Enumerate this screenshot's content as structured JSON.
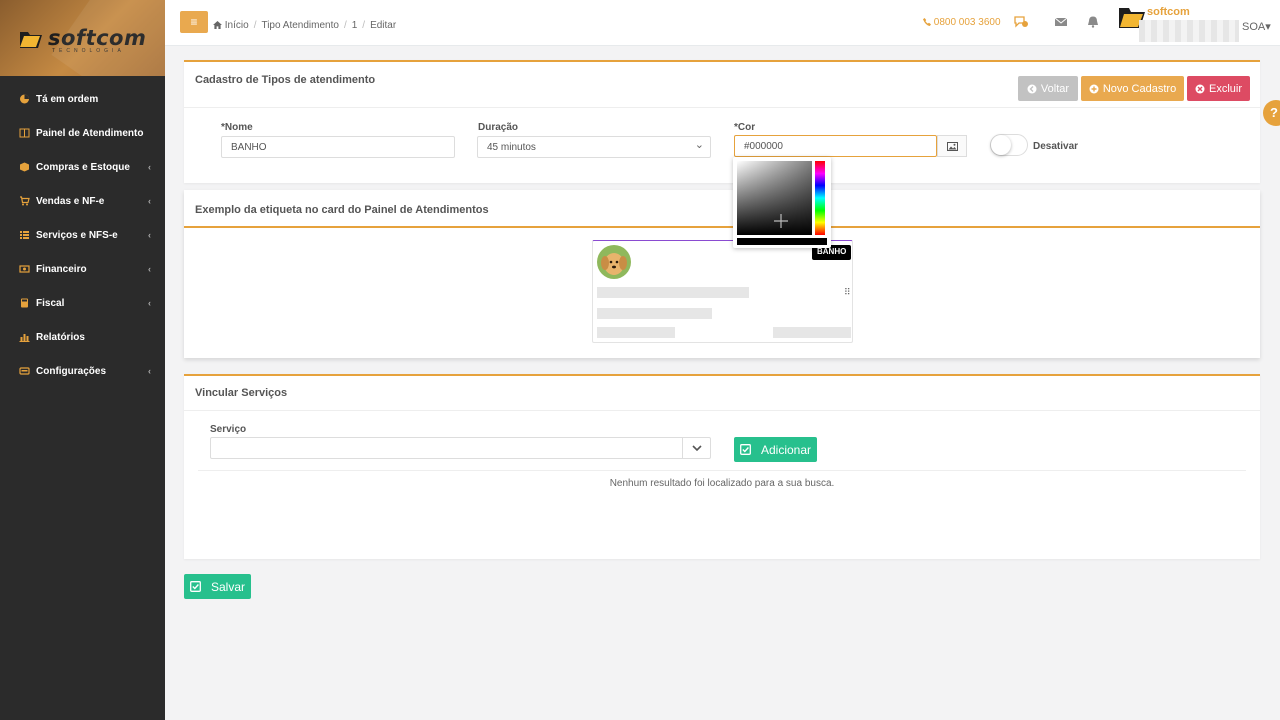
{
  "brand": {
    "logo_text": "softcom",
    "logo_sub": "TECNOLOGIA",
    "topbar_brand": "softcom",
    "user_suffix": "SOA▾"
  },
  "sidebar": {
    "items": [
      {
        "label": "Tá em ordem",
        "icon": "pie-chart-icon",
        "chevron": false
      },
      {
        "label": "Painel de Atendimento",
        "icon": "columns-icon",
        "chevron": false
      },
      {
        "label": "Compras e Estoque",
        "icon": "box-icon",
        "chevron": true
      },
      {
        "label": "Vendas e NF-e",
        "icon": "cart-icon",
        "chevron": true
      },
      {
        "label": "Serviços e NFS-e",
        "icon": "list-icon",
        "chevron": true
      },
      {
        "label": "Financeiro",
        "icon": "money-icon",
        "chevron": true
      },
      {
        "label": "Fiscal",
        "icon": "calculator-icon",
        "chevron": true
      },
      {
        "label": "Relatórios",
        "icon": "bar-chart-icon",
        "chevron": false
      },
      {
        "label": "Configurações",
        "icon": "keyboard-icon",
        "chevron": true
      }
    ],
    "chevron_glyph": "‹"
  },
  "topbar": {
    "menu_glyph": "≡",
    "breadcrumbs": [
      "Início",
      "Tipo Atendimento",
      "1",
      "Editar"
    ],
    "phone": "0800 003 3600"
  },
  "cadastro": {
    "title": "Cadastro de Tipos de atendimento",
    "btn_voltar": "Voltar",
    "btn_novo": "Novo Cadastro",
    "btn_excluir": "Excluir",
    "nome_label": "*Nome",
    "nome_value": "BANHO",
    "duracao_label": "Duração",
    "duracao_value": "45 minutos",
    "cor_label": "*Cor",
    "cor_value": "#000000",
    "toggle_label": "Desativar"
  },
  "exemplo": {
    "title": "Exemplo da etiqueta no card do Painel de Atendimentos",
    "tag_label": "BANHO",
    "dots": "⠿"
  },
  "vincular": {
    "title": "Vincular Serviços",
    "servico_label": "Serviço",
    "btn_adicionar": "Adicionar",
    "empty_message": "Nenhum resultado foi localizado para a sua busca."
  },
  "footer": {
    "btn_salvar": "Salvar"
  },
  "help_glyph": "?",
  "colors": {
    "accent": "#e6a23c",
    "success": "#27c08d",
    "danger": "#dd4b63",
    "muted": "#c2c2c2",
    "sidebar_bg": "#2b2b2b",
    "tag_color": "#000000"
  }
}
